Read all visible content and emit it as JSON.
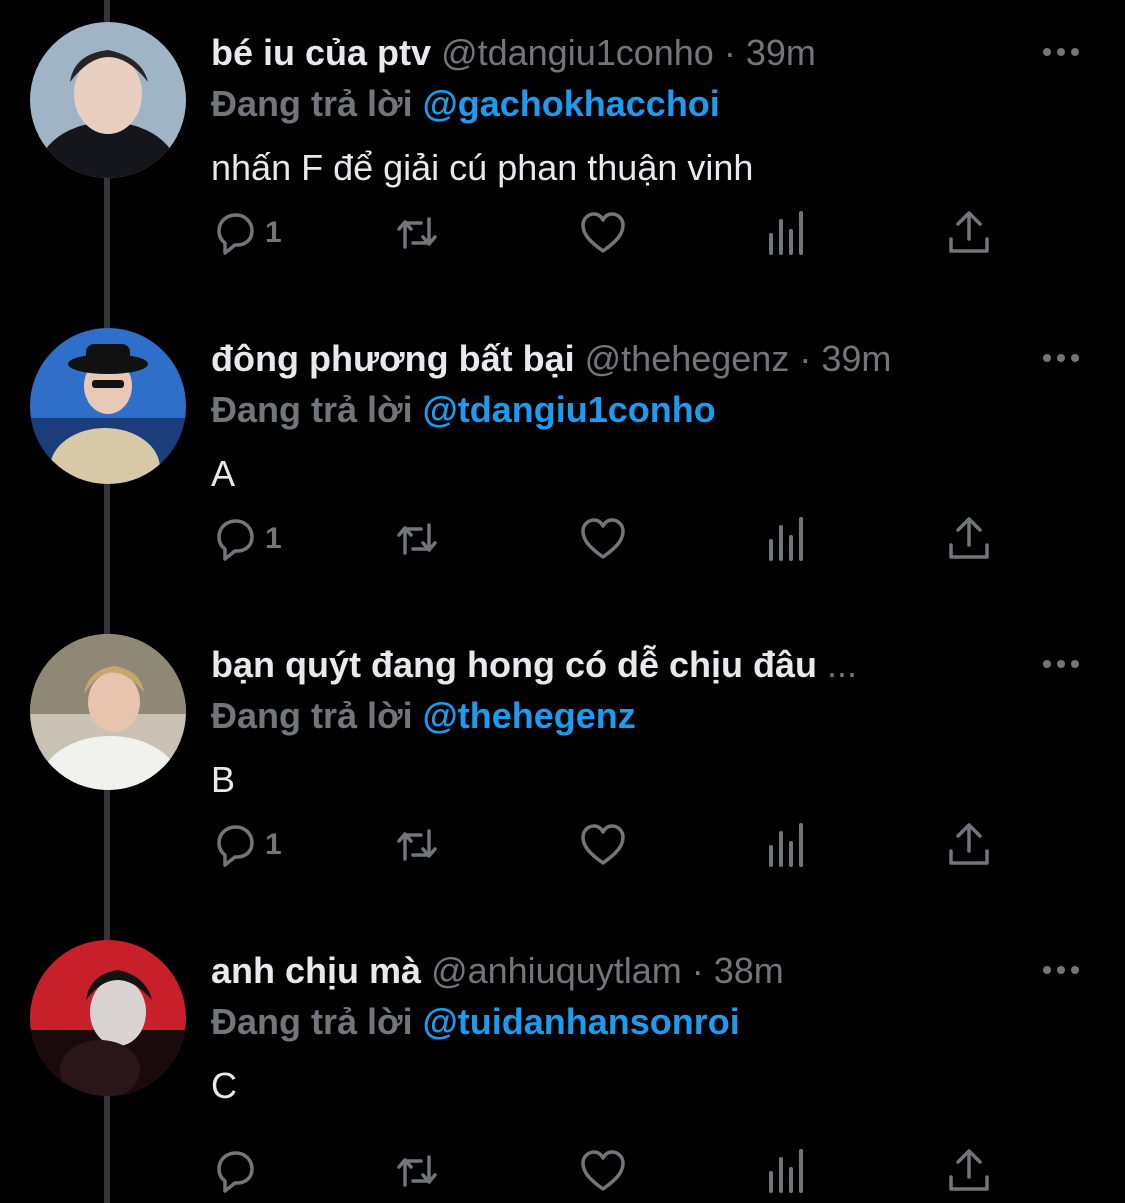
{
  "colors": {
    "background": "#000000",
    "text": "#e7e9ea",
    "muted": "#71767b",
    "mention": "#1d9bf0"
  },
  "tweets": [
    {
      "name": "bé iu của ptv",
      "handle": "@tdangiu1conho",
      "dot": " · ",
      "time": "39m",
      "reply_label": "Đang trả lời ",
      "reply_to": "@gachokhacchoi",
      "text": "nhấn F để giải cú phan thuận vinh",
      "reply_count": "1"
    },
    {
      "name": "đông phương bất bại",
      "handle": "@thehegenz",
      "dot": " · ",
      "time": "39m",
      "reply_label": "Đang trả lời ",
      "reply_to": "@tdangiu1conho",
      "text": "A",
      "reply_count": "1"
    },
    {
      "name": "bạn quýt đang hong có dễ chịu đâu",
      "handle": "",
      "dot": "",
      "time": "",
      "ellipsis": " ...",
      "reply_label": "Đang trả lời ",
      "reply_to": "@thehegenz",
      "text": "B",
      "reply_count": "1"
    },
    {
      "name": "anh chịu mà",
      "handle": "@anhiuquytlam",
      "dot": " · ",
      "time": "38m",
      "reply_label": "Đang trả lời ",
      "reply_to": "@tuidanhansonroi",
      "text": "C",
      "reply_count": ""
    }
  ]
}
